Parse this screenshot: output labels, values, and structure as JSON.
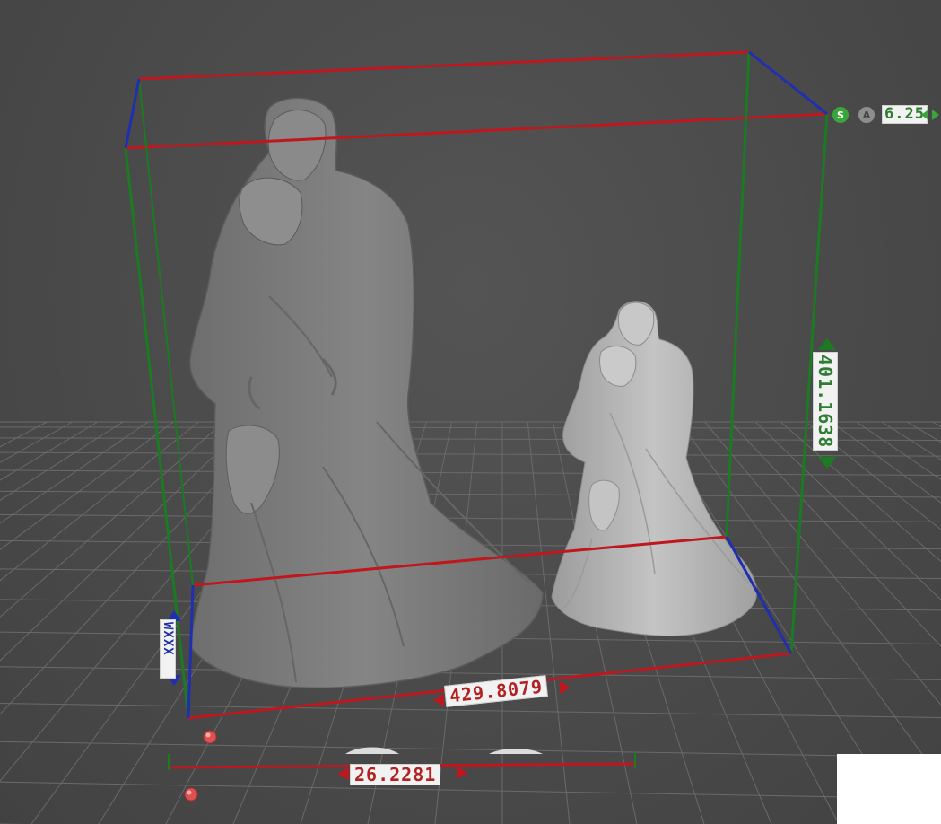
{
  "viewport": {
    "background": "#4a4a4a",
    "grid_color": "#6a6a6a",
    "model_color": "#7b7b7b"
  },
  "bounding_box": {
    "x_color": "#c0171e",
    "y_color": "#1c7a23",
    "z_color": "#1f2fb0"
  },
  "dimensions": {
    "width": "429.8079",
    "height": "401.1638",
    "depth": "WXXX",
    "base": "26.2281"
  },
  "toolbar": {
    "s_button": "S",
    "a_button": "A",
    "scale_value": "6.25"
  },
  "gizmo": {
    "handle_color": "#e05050"
  }
}
